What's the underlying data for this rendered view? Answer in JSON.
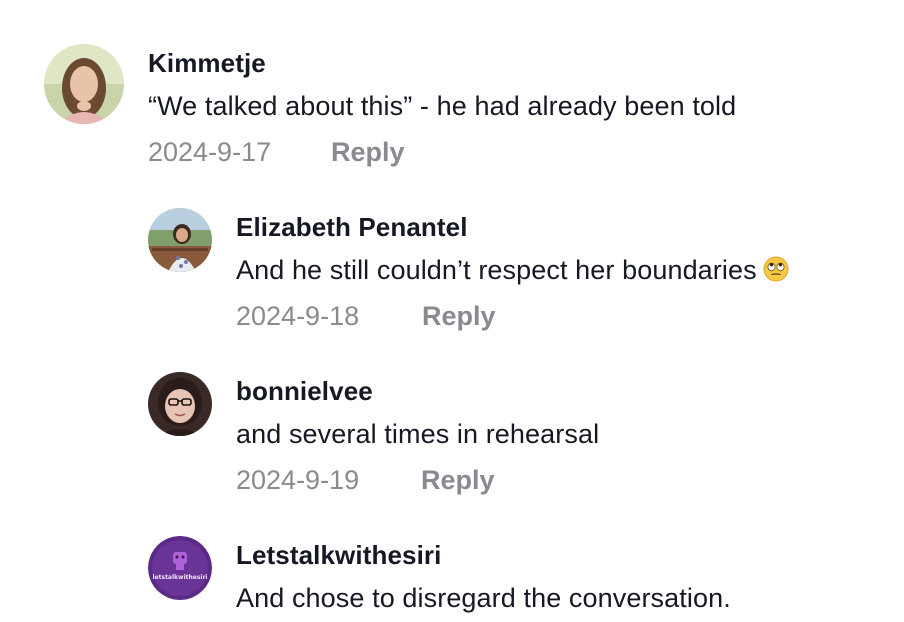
{
  "comments": [
    {
      "username": "Kimmetje",
      "text": "“We talked about this” - he had already been told",
      "date": "2024-9-17",
      "reply_label": "Reply",
      "avatar_icon": "avatar-photo-woman-long-hair"
    },
    {
      "username": "Elizabeth Penantel",
      "text": "And he still couldn’t respect her boundaries",
      "emoji_icon": "eye-roll-emoji-icon",
      "date": "2024-9-18",
      "reply_label": "Reply",
      "avatar_icon": "avatar-photo-woman-outdoors"
    },
    {
      "username": "bonnielvee",
      "text": "and several times in rehearsal",
      "date": "2024-9-19",
      "reply_label": "Reply",
      "avatar_icon": "avatar-photo-woman-glasses"
    },
    {
      "username": "Letstalkwithesiri",
      "text": "And chose to disregard the conversation.",
      "avatar_icon": "avatar-logo-purple",
      "avatar_logo_text": "letstalkwithesiri"
    }
  ],
  "colors": {
    "username": "#161823",
    "text": "#161823",
    "meta": "#8a8b91",
    "logo_purple": "#5b2a86"
  }
}
